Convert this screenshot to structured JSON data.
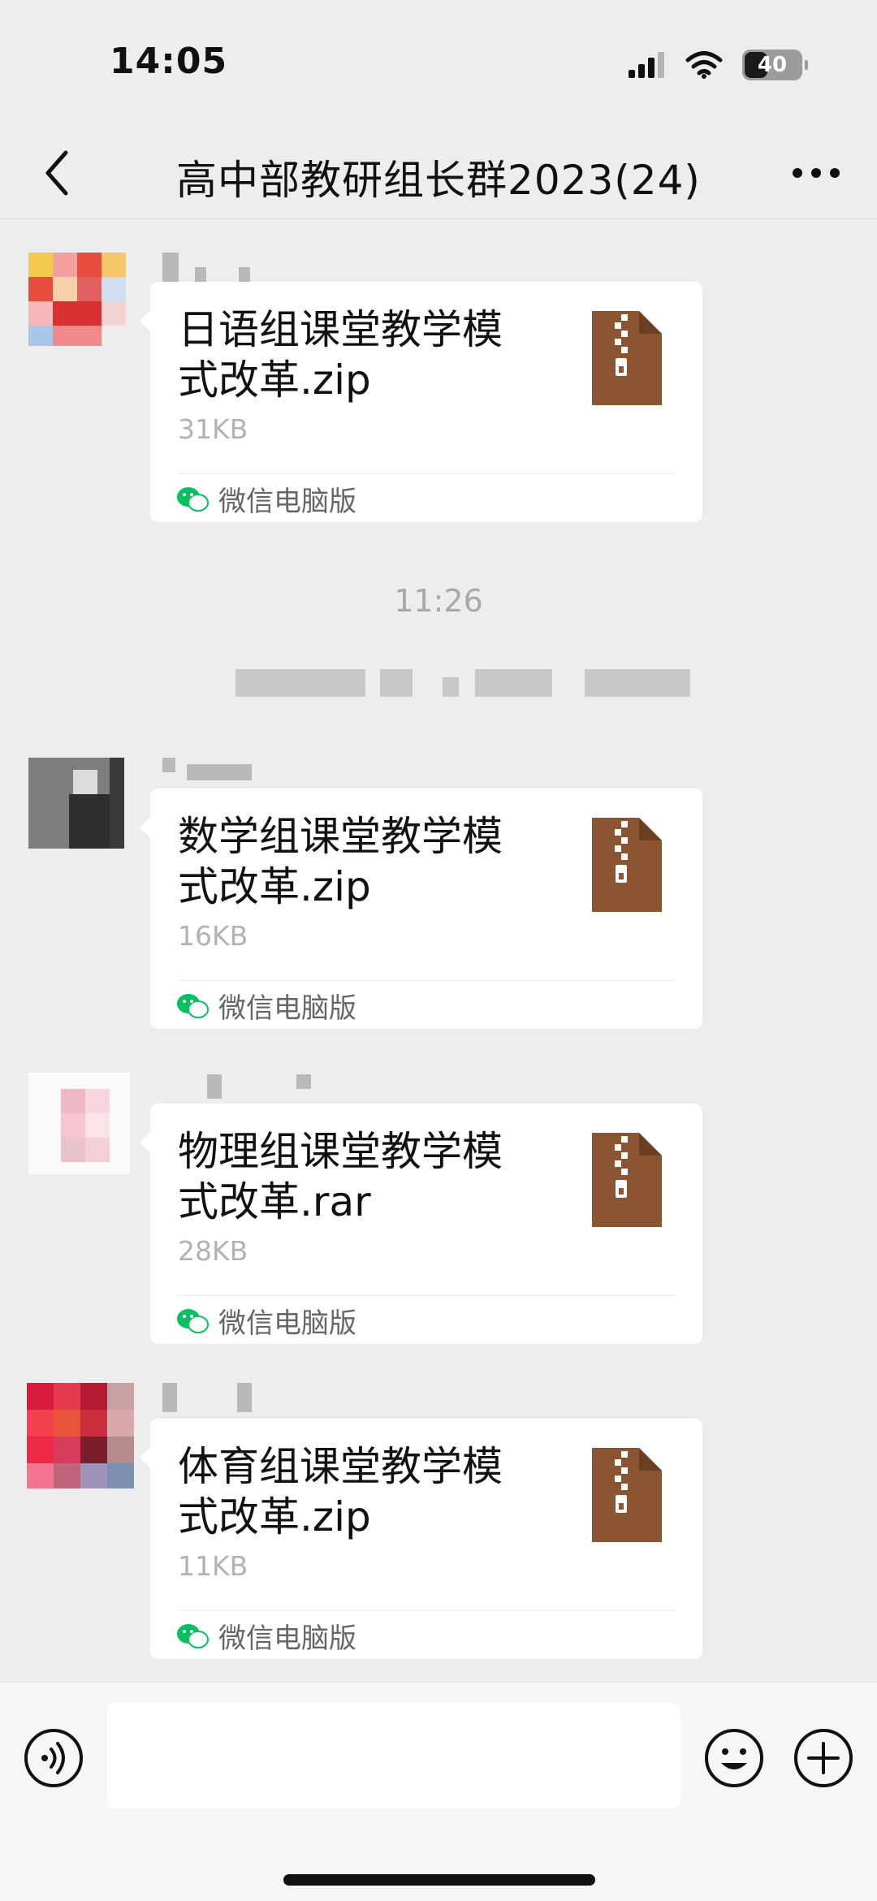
{
  "status_bar": {
    "time": "14:05",
    "battery": "40",
    "icons": [
      "signal-icon",
      "wifi-icon",
      "battery-icon"
    ]
  },
  "nav": {
    "title": "高中部教研组长群2023(24)",
    "back_icon": "chevron-left-icon",
    "more_icon": "more-horizontal-icon"
  },
  "messages": [
    {
      "file_name": "日语组课堂教学模式改革.zip",
      "file_size": "31KB",
      "source": "微信电脑版",
      "file_icon": "zip-archive-icon"
    },
    {
      "file_name": "数学组课堂教学模式改革.zip",
      "file_size": "16KB",
      "source": "微信电脑版",
      "file_icon": "zip-archive-icon"
    },
    {
      "file_name": "物理组课堂教学模式改革.rar",
      "file_size": "28KB",
      "source": "微信电脑版",
      "file_icon": "zip-archive-icon"
    },
    {
      "file_name": "体育组课堂教学模式改革.zip",
      "file_size": "11KB",
      "source": "微信电脑版",
      "file_icon": "zip-archive-icon"
    }
  ],
  "timestamp": "11:26",
  "colors": {
    "background": "#ededed",
    "bubble": "#ffffff",
    "file_icon": "#8a5530",
    "wechat_green": "#07c160"
  },
  "input_bar": {
    "placeholder": "",
    "voice_icon": "voice-icon",
    "emoji_icon": "emoji-icon",
    "plus_icon": "plus-circle-icon"
  }
}
